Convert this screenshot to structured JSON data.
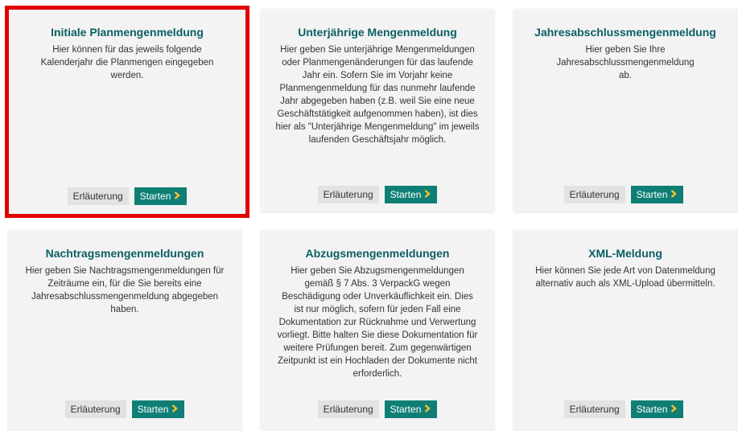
{
  "colors": {
    "title": "#0b5f65",
    "start_button": "#0f7f76",
    "start_chevron": "#f2c230",
    "selection_outline": "#e10000"
  },
  "cards": [
    {
      "title": "Initiale Planmengenmeldung",
      "description": "Hier können für das jeweils folgende Kalenderjahr die Planmengen eingegeben werden.",
      "info_label": "Erläuterung",
      "start_label": "Starten",
      "start_icon": "chevron-right-icon"
    },
    {
      "title": "Unterjährige Mengenmeldung",
      "description": "Hier geben Sie unterjährige Mengenmeldungen oder Planmengenänderungen für das laufende Jahr ein. Sofern Sie im Vorjahr keine Planmengenmeldung für das nunmehr laufende Jahr abgegeben haben (z.B. weil Sie eine neue Geschäftstätigkeit aufgenommen haben), ist dies hier als \"Unterjährige Mengenmeldung\" im jeweils laufenden Geschäftsjahr möglich.",
      "info_label": "Erläuterung",
      "start_label": "Starten",
      "start_icon": "chevron-right-icon"
    },
    {
      "title": "Jahresabschlussmengenmeldung",
      "description": "Hier geben Sie Ihre Jahresabschlussmengenmeldung ab.",
      "info_label": "Erläuterung",
      "start_label": "Starten",
      "start_icon": "chevron-right-icon"
    },
    {
      "title": "Nachtragsmengenmeldungen",
      "description": "Hier geben Sie Nachtragsmengenmeldungen für Zeiträume ein, für die Sie bereits eine Jahresabschlussmengenmeldung abgegeben haben.",
      "info_label": "Erläuterung",
      "start_label": "Starten",
      "start_icon": "chevron-right-icon"
    },
    {
      "title": "Abzugsmengenmeldungen",
      "description": "Hier geben Sie Abzugsmengenmeldungen gemäß § 7 Abs. 3 VerpackG wegen Beschädigung oder Unverkäuflichkeit ein. Dies ist nur möglich, sofern für jeden Fall eine Dokumentation zur Rücknahme und Verwertung vorliegt. Bitte halten Sie diese Dokumentation für weitere Prüfungen bereit. Zum gegenwärtigen Zeitpunkt ist ein Hochladen der Dokumente nicht erforderlich.",
      "info_label": "Erläuterung",
      "start_label": "Starten",
      "start_icon": "chevron-right-icon"
    },
    {
      "title": "XML-Meldung",
      "description": "Hier können Sie jede Art von Datenmeldung alternativ auch als XML-Upload übermitteln.",
      "info_label": "Erläuterung",
      "start_label": "Starten",
      "start_icon": "chevron-right-icon"
    }
  ]
}
